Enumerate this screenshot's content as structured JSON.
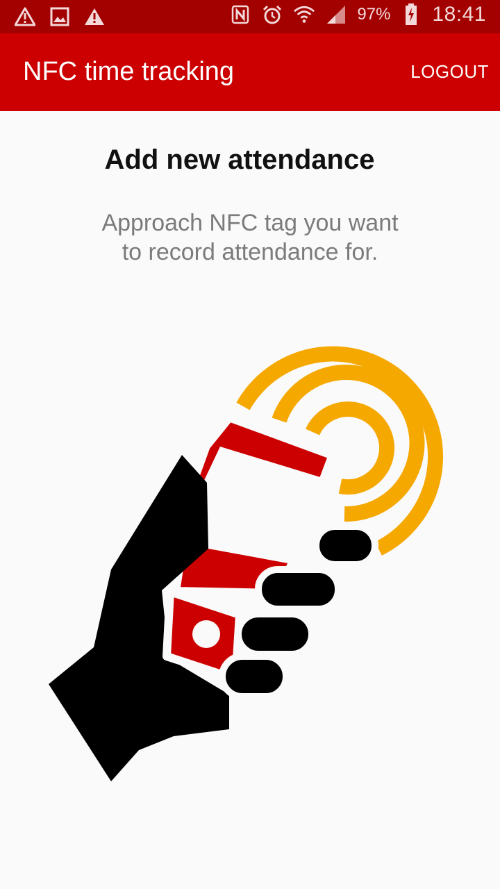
{
  "status_bar": {
    "icons_left": [
      "warning-icon",
      "image-icon",
      "warning-icon"
    ],
    "icons_right": [
      "nfc-icon",
      "alarm-icon",
      "wifi-icon",
      "signal-icon",
      "battery-charging-icon"
    ],
    "battery": "97%",
    "time": "18:41"
  },
  "app_bar": {
    "title": "NFC time tracking",
    "logout_label": "LOGOUT",
    "color": "#cc0000"
  },
  "main": {
    "heading": "Add new attendance",
    "instructions": "Approach NFC tag you want to record attendance for.",
    "illustration": "nfc-hand-phone-icon",
    "accent_colors": {
      "phone": "#cc0000",
      "waves": "#f5a800",
      "hand": "#000000"
    }
  }
}
